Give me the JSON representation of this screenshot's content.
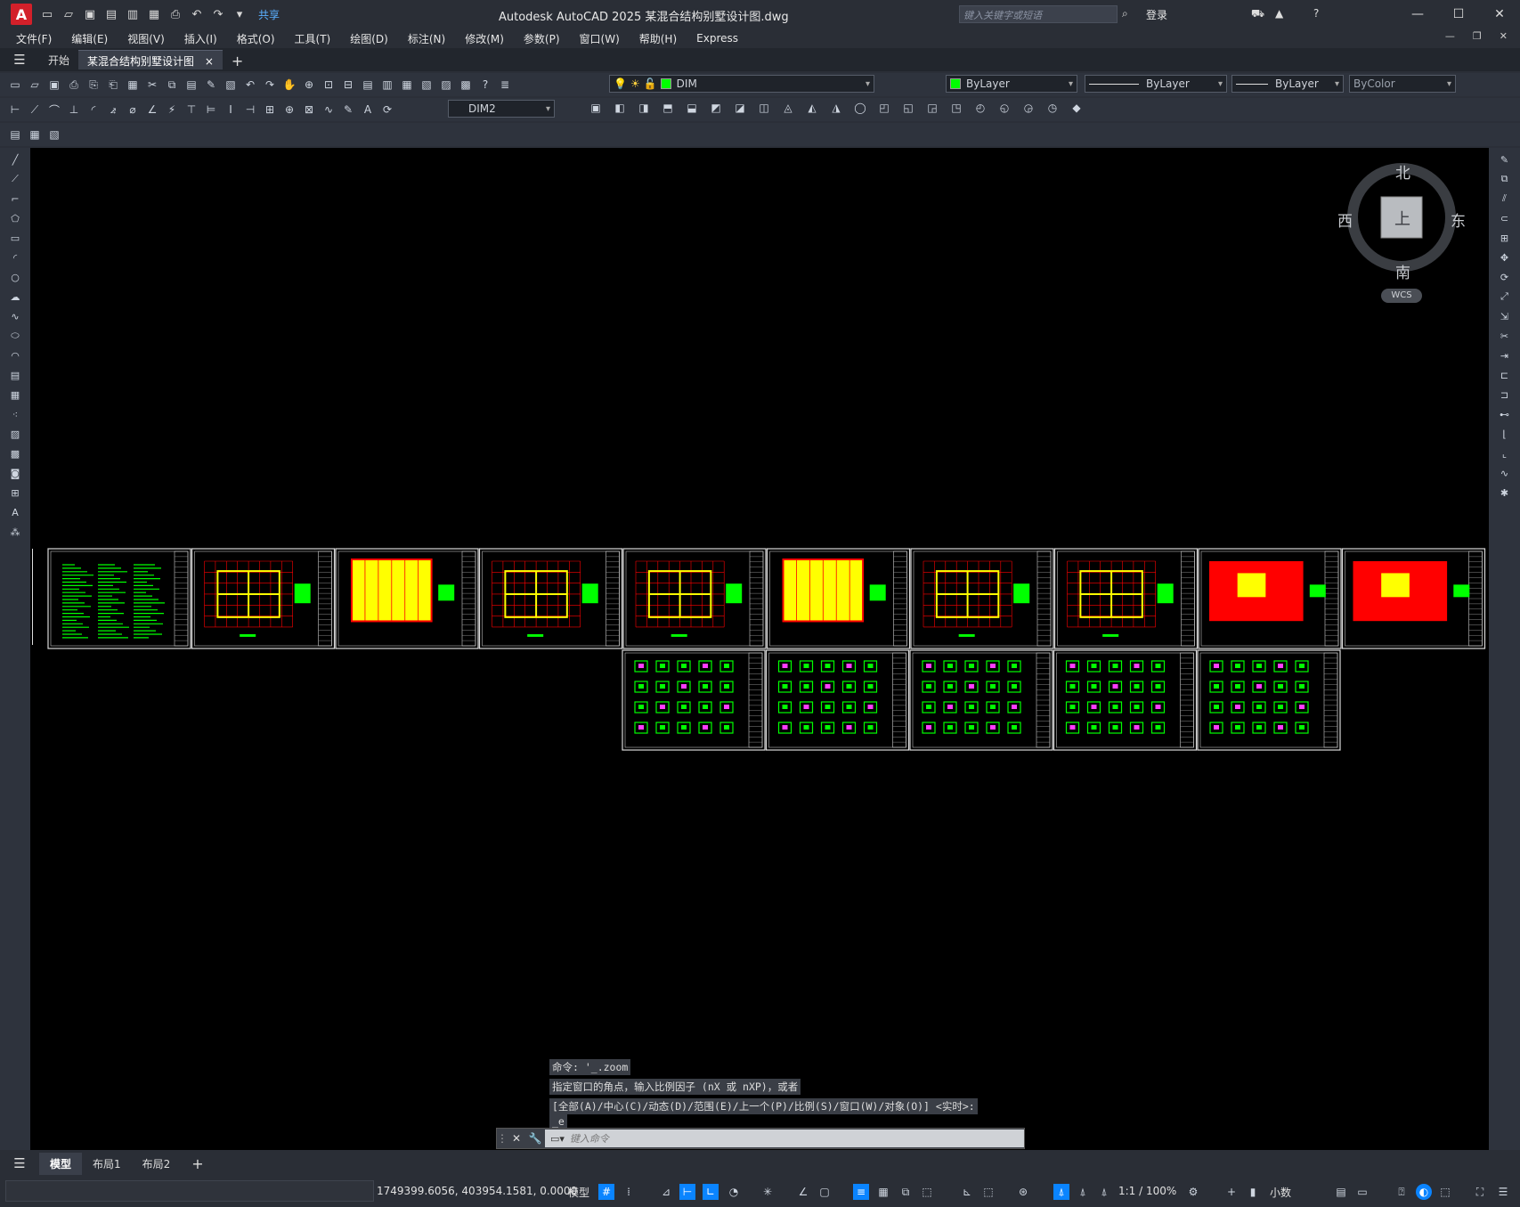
{
  "app": {
    "logo_letter": "A",
    "title": "Autodesk AutoCAD 2025    某混合结构别墅设计图.dwg",
    "share_label": "共享",
    "search_placeholder": "键入关键字或短语",
    "login_label": "登录"
  },
  "menu": [
    "文件(F)",
    "编辑(E)",
    "视图(V)",
    "插入(I)",
    "格式(O)",
    "工具(T)",
    "绘图(D)",
    "标注(N)",
    "修改(M)",
    "参数(P)",
    "窗口(W)",
    "帮助(H)",
    "Express"
  ],
  "tabs": {
    "start": "开始",
    "drawing": "某混合结构别墅设计图",
    "close": "×",
    "add": "+"
  },
  "properties": {
    "layer": "DIM",
    "color": "ByLayer",
    "linetype": "ByLayer",
    "lineweight": "ByLayer",
    "plotstyle": "ByColor",
    "dimstyle": "DIM2",
    "layer_color": "#00ff00",
    "color_swatch": "#00ff00"
  },
  "viewcube": {
    "north": "北",
    "south": "南",
    "east": "东",
    "west": "西",
    "top": "上",
    "wcs": "WCS"
  },
  "command": {
    "history": [
      "命令: '_.zoom",
      "指定窗口的角点，输入比例因子 (nX 或 nXP)，或者",
      "[全部(A)/中心(C)/动态(D)/范围(E)/上一个(P)/比例(S)/窗口(W)/对象(O)] <实时>:",
      "_e"
    ],
    "placeholder": "键入命令"
  },
  "layout_tabs": [
    "模型",
    "布局1",
    "布局2"
  ],
  "status": {
    "coordinates": "1749399.6056, 403954.1581, 0.0000",
    "model_label": "模型",
    "scale": "1:1 / 100%",
    "units": "小数"
  },
  "colors": {
    "canvas": "#000000",
    "accent": "#0a84ff",
    "drawing_green": "#00ff00",
    "drawing_yellow": "#ffff00",
    "drawing_red": "#ff0000"
  }
}
